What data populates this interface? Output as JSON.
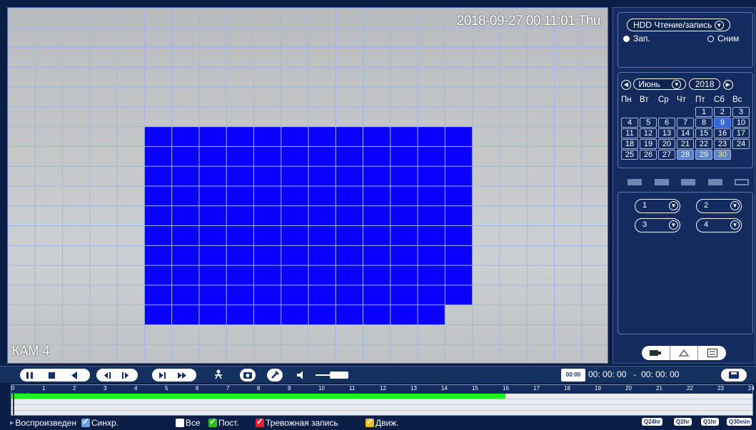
{
  "video": {
    "timestamp": "2018-09-27 00:11:01 Thu",
    "camera_label": "КАМ 4",
    "motion_grid_color": "#0a00ff",
    "grid_line_color": "#9fb8e8"
  },
  "panel": {
    "mode_select": "HDD Чтение/запись",
    "radio_record": "Зап.",
    "radio_snapshot": "Сним",
    "calendar": {
      "month": "Июнь",
      "year": "2018",
      "weekdays": [
        "Пн",
        "Вт",
        "Ср",
        "Чт",
        "Пт",
        "Сб",
        "Вс"
      ],
      "days": [
        "",
        "",
        "",
        "",
        "1",
        "2",
        "3",
        "4",
        "5",
        "6",
        "7",
        "8",
        "9",
        "10",
        "11",
        "12",
        "13",
        "14",
        "15",
        "16",
        "17",
        "18",
        "19",
        "20",
        "21",
        "22",
        "23",
        "24",
        "25",
        "26",
        "27",
        "28",
        "29",
        "30",
        ""
      ],
      "selected_day": "9",
      "highlight_days": [
        "28",
        "29"
      ],
      "today_day": "30"
    },
    "channels": [
      "1",
      "2",
      "3",
      "4"
    ]
  },
  "controls": {
    "time_start": "00: 00: 00",
    "time_sep": "-",
    "time_end": "00: 00: 00",
    "time_badge": "00:00",
    "volume_icon": "speaker-icon"
  },
  "timeline": {
    "hours": [
      "0",
      "1",
      "2",
      "3",
      "4",
      "5",
      "6",
      "7",
      "8",
      "9",
      "10",
      "11",
      "12",
      "13",
      "14",
      "15",
      "16",
      "17",
      "18",
      "19",
      "20",
      "21",
      "22",
      "23",
      "24"
    ],
    "cursor_time": "00:11:01",
    "recorded_until_hour": 16.1,
    "record_color": "#1ef21e"
  },
  "legend": {
    "playback_label": "Воспроизведен",
    "sync_label": "Синхр.",
    "all_label": "Все",
    "regular_label": "Пост.",
    "alarm_label": "Тревожная запись",
    "motion_label": "Движ.",
    "zoom_24": "24hr",
    "zoom_2": "2hr",
    "zoom_1": "1hr",
    "zoom_30": "30min"
  }
}
